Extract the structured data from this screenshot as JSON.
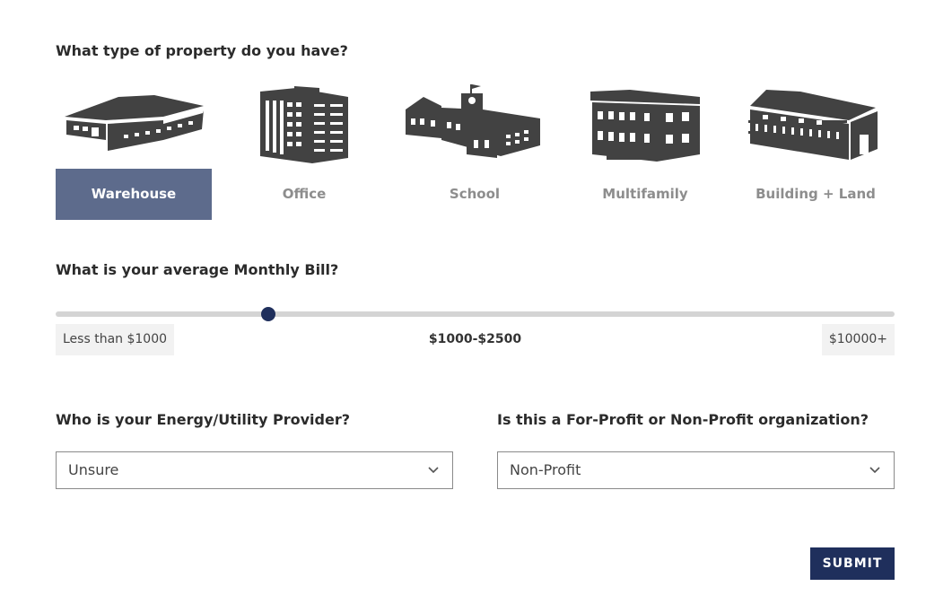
{
  "property_question": "What type of property do you have?",
  "property_types": [
    {
      "label": "Warehouse",
      "icon": "warehouse-icon",
      "selected": true
    },
    {
      "label": "Office",
      "icon": "office-building-icon",
      "selected": false
    },
    {
      "label": "School",
      "icon": "school-icon",
      "selected": false
    },
    {
      "label": "Multifamily",
      "icon": "multifamily-icon",
      "selected": false
    },
    {
      "label": "Building + Land",
      "icon": "building-land-icon",
      "selected": false
    }
  ],
  "bill_question": "What is your average Monthly Bill?",
  "bill_slider": {
    "min_label": "Less than $1000",
    "max_label": "$10000+",
    "current_label": "$1000-$2500",
    "value_fraction": 0.254
  },
  "provider_question": "Who is your Energy/Utility Provider?",
  "provider_select": {
    "value": "Unsure",
    "icon": "chevron-down-icon"
  },
  "org_question": "Is this a For-Profit or Non-Profit organization?",
  "org_select": {
    "value": "Non-Profit",
    "icon": "chevron-down-icon"
  },
  "submit_label": "SUBMIT",
  "colors": {
    "selected_bg": "#5d6b8c",
    "primary": "#1f2f5c",
    "icon_fill": "#424242",
    "muted_text": "#8d8d8d"
  }
}
